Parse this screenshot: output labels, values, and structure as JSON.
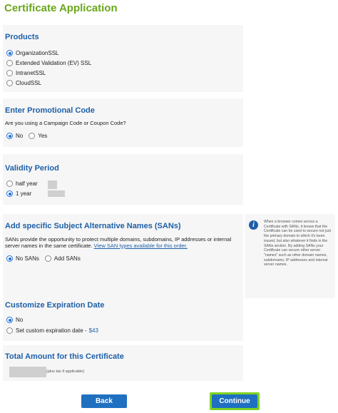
{
  "page": {
    "title": "Certificate Application"
  },
  "products": {
    "title": "Products",
    "options": [
      {
        "label": "OrganizationSSL",
        "checked": true
      },
      {
        "label": "Extended Validation (EV) SSL",
        "checked": false
      },
      {
        "label": "IntranetSSL",
        "checked": false
      },
      {
        "label": "CloudSSL",
        "checked": false
      }
    ]
  },
  "promo": {
    "title": "Enter Promotional Code",
    "question": "Are you using a Campaign Code or Coupon Code?",
    "no_label": "No",
    "yes_label": "Yes",
    "selected": "No"
  },
  "validity": {
    "title": "Validity Period",
    "options": [
      {
        "label": "half year",
        "checked": false
      },
      {
        "label": "1 year",
        "checked": true
      }
    ]
  },
  "sans": {
    "title": "Add specific Subject Alternative Names (SANs)",
    "description": "SANs provide the opportunity to protect multiple domains, subdomains, IP addresses or internal server names in the same certificate.",
    "link_text": "View SAN types available for this order.",
    "no_label": "No SANs",
    "add_label": "Add SANs",
    "selected": "No SANs",
    "info_text": "When a browser comes across a Certificate with SANs, it knows that the Certificate can be used to secure not just the primary domain to which it's been issued, but also whatever it finds in the SANs section. By adding SANs your Certificate can secure other server \"names\" such as other domain names, subdomains, IP addresses and internal server names."
  },
  "expiration": {
    "title": "Customize Expiration Date",
    "no_label": "No",
    "custom_label": "Set custom expiration date -",
    "custom_price": "$43",
    "selected": "No"
  },
  "total": {
    "title": "Total Amount for this Certificate",
    "note": "(plus tax if applicable)"
  },
  "buttons": {
    "back": "Back",
    "continue": "Continue"
  },
  "colors": {
    "accent_green": "#6aa61a",
    "heading_blue": "#1d5fa8",
    "button_blue": "#1f70c1",
    "continue_highlight": "#7dd321"
  }
}
